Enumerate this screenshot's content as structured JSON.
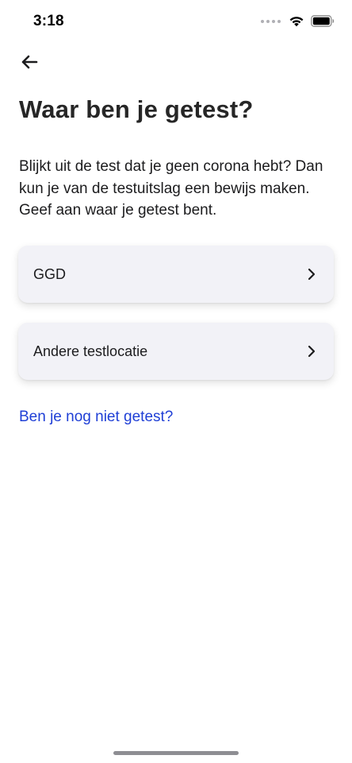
{
  "status_bar": {
    "time": "3:18"
  },
  "header": {
    "back_icon": "arrow-left-icon",
    "title": "Waar ben je getest?"
  },
  "intro": {
    "text": "Blijkt uit de test dat je geen corona hebt? Dan kun je van de testuitslag een bewijs maken. Geef aan waar je getest bent."
  },
  "options": [
    {
      "label": "GGD",
      "icon": "chevron-right-icon"
    },
    {
      "label": "Andere testlocatie",
      "icon": "chevron-right-icon"
    }
  ],
  "link": {
    "label": "Ben je nog niet getest?",
    "color": "#1f3fd6"
  },
  "colors": {
    "card_background": "#f2f2f7",
    "title": "#262626"
  }
}
